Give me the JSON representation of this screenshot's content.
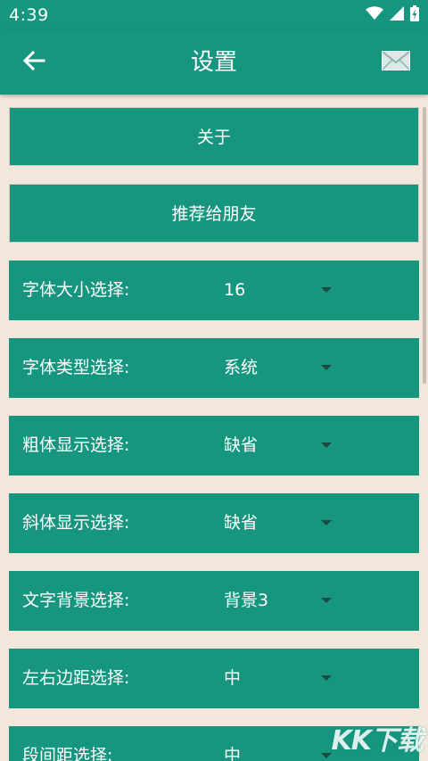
{
  "status_bar": {
    "time": "4:39",
    "icons": [
      "wifi-icon",
      "signal-icon",
      "battery-icon"
    ]
  },
  "app_bar": {
    "title": "设置",
    "back_icon": "arrow-left-icon",
    "mail_icon": "envelope-icon"
  },
  "actions": [
    {
      "label": "关于"
    },
    {
      "label": "推荐给朋友"
    }
  ],
  "settings": [
    {
      "label": "字体大小选择:",
      "value": "16"
    },
    {
      "label": "字体类型选择:",
      "value": "系统"
    },
    {
      "label": "粗体显示选择:",
      "value": "缺省"
    },
    {
      "label": "斜体显示选择:",
      "value": "缺省"
    },
    {
      "label": "文字背景选择:",
      "value": "背景3"
    },
    {
      "label": "左右边距选择:",
      "value": "中"
    },
    {
      "label": "段间距选择:",
      "value": "中"
    }
  ],
  "watermark": "KK下载",
  "colors": {
    "primary": "#16957f",
    "background": "#f3e7db",
    "text": "#ffffff",
    "arrow": "#1c4a40"
  }
}
